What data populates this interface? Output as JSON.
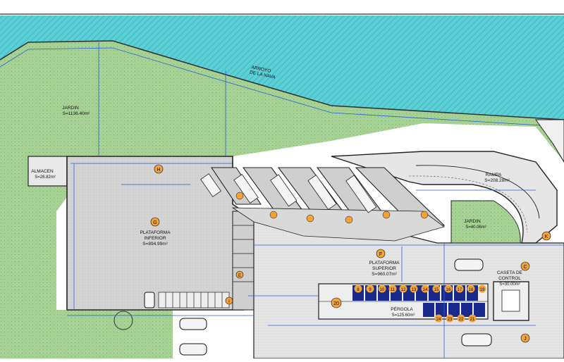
{
  "labels": {
    "arroyo_1": "ARROYO",
    "arroyo_2": "DE LA NAVA",
    "jardin_big": "JARDIN",
    "jardin_big_area": "S=1136.40m²",
    "almacen": "ALMACEN",
    "almacen_area": "S=26.82m²",
    "rampa": "RAMPA",
    "rampa_area": "S=208.28m²",
    "jardin_small": "JARDIN",
    "jardin_small_area": "S=40.06m²",
    "plataforma_inf_1": "PLATAFORMA",
    "plataforma_inf_2": "INFERIOR",
    "plataforma_inf_area": "S=894.99m²",
    "plataforma_sup_1": "PLATAFORMA",
    "plataforma_sup_2": "SUPERIOR",
    "plataforma_sup_area": "S=960.07m²",
    "pergola": "PÉRGOLA",
    "pergola_area": "S=125.60m²",
    "caseta_1": "CASETA DE",
    "caseta_2": "CONTROL",
    "caseta_area": "S=30.00m²"
  },
  "markers": {
    "H": "H",
    "G": "G",
    "F": "F",
    "I": "I",
    "J": "J",
    "C": "C",
    "E": "E",
    "K": "K",
    "N20": "20",
    "row_top": [
      "8",
      "9",
      "10",
      "11",
      "12",
      "13",
      "14",
      "15",
      "16",
      "17",
      "18",
      "19"
    ],
    "row_bottom": [
      "24",
      "23",
      "22",
      "21"
    ]
  },
  "colors": {
    "water": "#4fc9cf",
    "garden": "#a9d39a",
    "platform": "#d6d6d6",
    "parking": "#e3e3e3",
    "dimension_line": "#2a5fd6",
    "marker": "#f2a238",
    "stall": "#1a2a8c"
  }
}
